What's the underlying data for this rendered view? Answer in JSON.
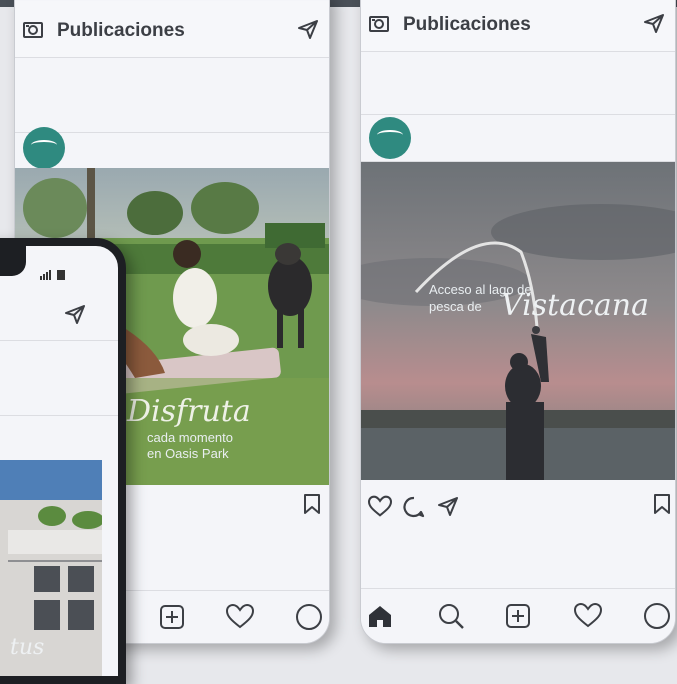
{
  "app": {
    "header_title": "Publicaciones"
  },
  "post_left": {
    "caption_script": "Disfruta",
    "caption_line1": "cada momento",
    "caption_line2": "en Oasis Park"
  },
  "post_right": {
    "caption_line1": "Acceso al lago de",
    "caption_line2": "pesca de",
    "caption_script": "Vistacana"
  },
  "front_phone": {
    "caption_script": "tus"
  },
  "colors": {
    "accent_teal": "#2f8a80",
    "icon_stroke": "#3c3f45",
    "bezel": "#1d1f23"
  },
  "icons": [
    "camera-icon",
    "send-icon",
    "bookmark-icon",
    "heart-icon",
    "comment-icon",
    "home-icon",
    "search-icon",
    "add-icon",
    "profile-icon",
    "signal-icon",
    "battery-icon"
  ]
}
